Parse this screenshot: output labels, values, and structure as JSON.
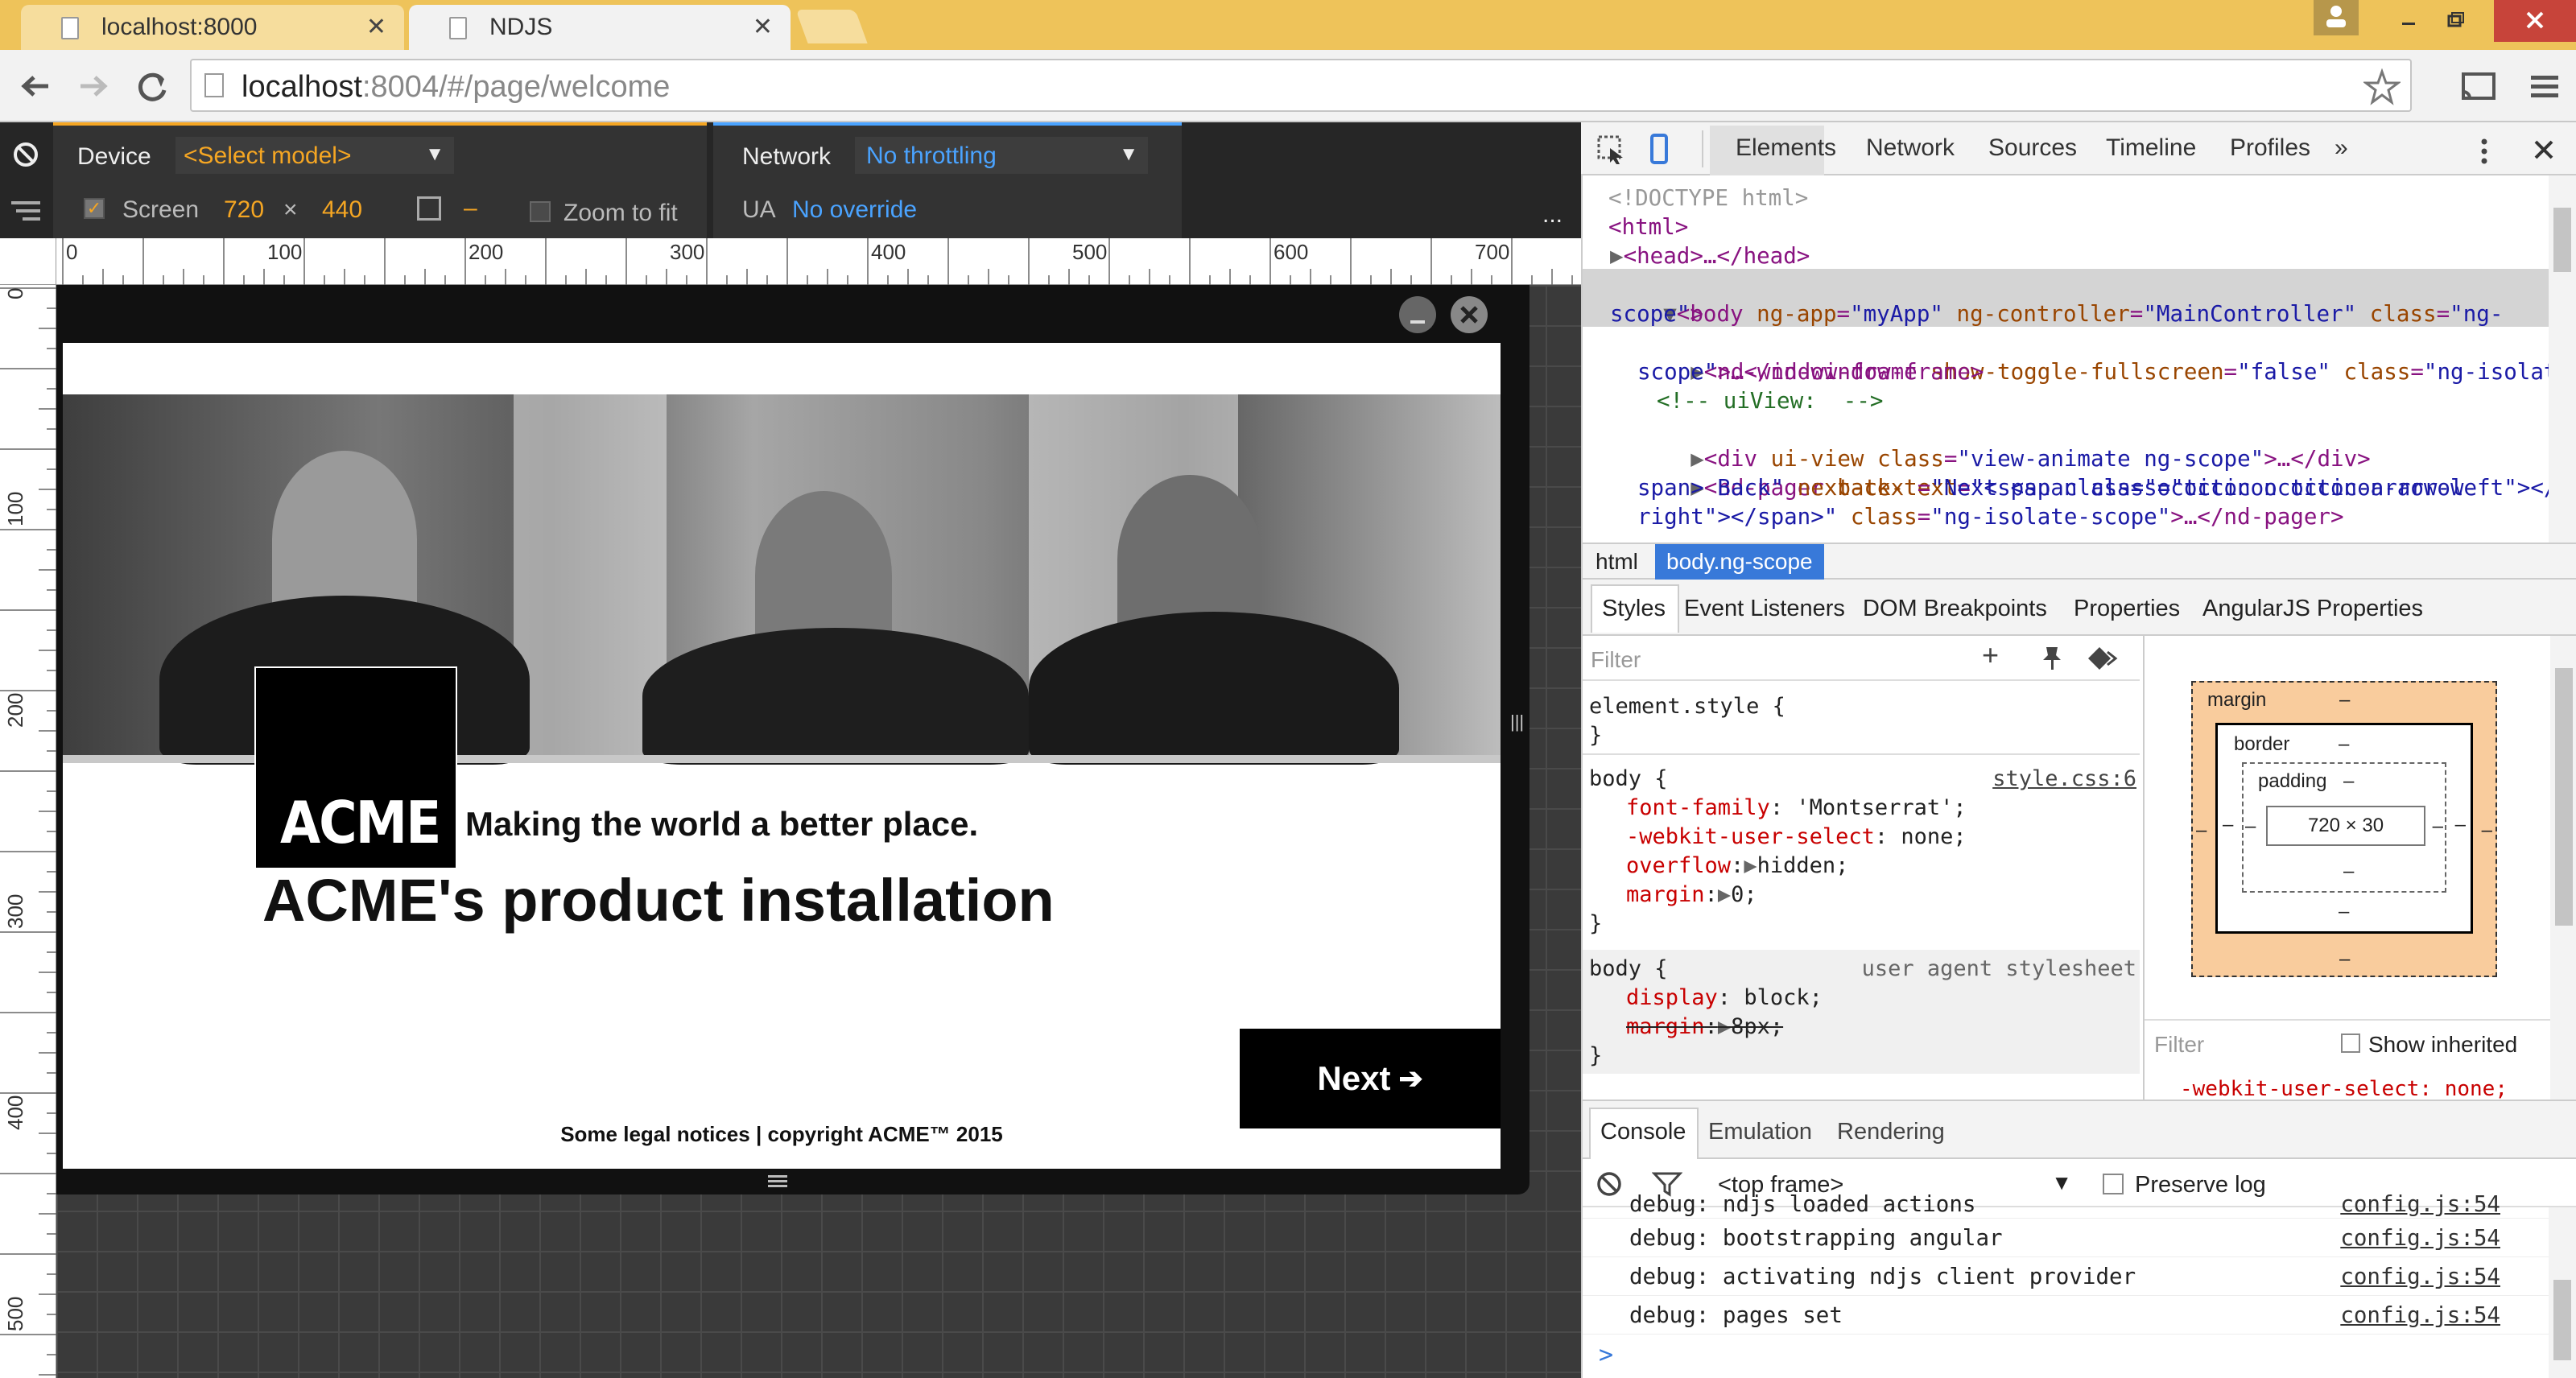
{
  "browser": {
    "tabs": [
      {
        "label": "localhost:8000",
        "active": false
      },
      {
        "label": "NDJS",
        "active": true
      }
    ],
    "url": {
      "host": "localhost",
      "rest": ":8004/#/page/welcome"
    }
  },
  "device_toolbar": {
    "device_label": "Device",
    "device_model": "<Select model>",
    "screen_label": "Screen",
    "screen_width": "720",
    "times": "×",
    "screen_height": "440",
    "dash": "–",
    "zoom_to_fit": "Zoom to fit",
    "network_label": "Network",
    "network_value": "No throttling",
    "ua_label": "UA",
    "ua_value": "No override",
    "more": "..."
  },
  "ruler": {
    "h_ticks": [
      "0",
      "100",
      "200",
      "300",
      "400",
      "500",
      "600",
      "700"
    ],
    "v_ticks": [
      "0",
      "100",
      "200",
      "300",
      "400",
      "500"
    ]
  },
  "app": {
    "logo": "ACME",
    "tagline": "Making the world a better place.",
    "title": "ACME's product installation",
    "next_button": "Next",
    "legal": "Some legal notices | copyright ACME™ 2015"
  },
  "devtools": {
    "tabs": [
      "Elements",
      "Network",
      "Sources",
      "Timeline",
      "Profiles",
      "»"
    ],
    "active_tab": "Elements",
    "breadcrumbs": [
      "html",
      "body.ng-scope"
    ],
    "style_tabs": [
      "Styles",
      "Event Listeners",
      "DOM Breakpoints",
      "Properties",
      "AngularJS Properties"
    ],
    "filter_placeholder": "Filter",
    "element_style": "element.style {",
    "close_brace": "}",
    "rule1_selector": "body {",
    "rule1_source": "style.css:6",
    "rule1_props": [
      {
        "name": "font-family",
        "value": "'Montserrat';"
      },
      {
        "name": "-webkit-user-select",
        "value": "none;"
      },
      {
        "name": "overflow",
        "value": "hidden;"
      },
      {
        "name": "margin",
        "value": "0;"
      }
    ],
    "rule2_selector": "body {",
    "rule2_source": "user agent stylesheet",
    "rule2_props": [
      {
        "name": "display",
        "value": "block;"
      },
      {
        "name": "margin",
        "value": "8px;"
      }
    ],
    "boxmodel": {
      "margin": "margin",
      "border": "border",
      "padding": "padding",
      "dash": "–",
      "content": "720 × 30"
    },
    "computed_filter": "Filter",
    "show_inherited": "Show inherited",
    "computed_preview": "-webkit-user-select: none;",
    "console_tabs": [
      "Console",
      "Emulation",
      "Rendering"
    ],
    "frame_select": "<top frame>",
    "preserve_log": "Preserve log",
    "console_partial": "debug: ndjs loaded actions",
    "console_partial_source": "config.js:54",
    "console_lines": [
      {
        "msg": "debug: bootstrapping angular",
        "src": "config.js:54"
      },
      {
        "msg": "debug: activating ndjs client provider",
        "src": "config.js:54"
      },
      {
        "msg": "debug: pages set",
        "src": "config.js:54"
      }
    ],
    "prompt": ">"
  },
  "dom_tree": {
    "doctype": "<!DOCTYPE html>",
    "html_open": "<html>",
    "head": "<head>…</head>",
    "body_tag": "<body",
    "body_attr1": "ng-app",
    "body_val1": "\"myApp\"",
    "body_attr2": "ng-controller",
    "body_val2": "\"MainController\"",
    "body_attr3": "class",
    "body_val3a": "\"ng-",
    "body_val3b": "scope\"",
    "body_close": ">",
    "frame_tag": "<nd-window-frame",
    "frame_attr1": "show-toggle-fullscreen",
    "frame_val1": "\"false\"",
    "frame_attr2": "class",
    "frame_val2a": "\"ng-isolate-",
    "frame_val2b": "scope\"",
    "frame_end": ">…</nd-window-frame>",
    "comment": "<!-- uiView:  -->",
    "div_tag": "<div",
    "div_attr1": "ui-view",
    "div_attr2": "class",
    "div_val2": "\"view-animate ng-scope\"",
    "div_end": ">…</div>",
    "pager_tag": "<nd-pager",
    "pager_attr1": "back-text",
    "pager_val1a": "\"<span class=\"octicon octicon-arrow-left\"></",
    "pager_val1b": "span> Back\"",
    "pager_attr2": "next-text",
    "pager_val2a": "\"Next <span class=\"octicon octicon-arrow-",
    "pager_val2b": "right\"></span>\"",
    "pager_attr3": "class",
    "pager_val3": "\"ng-isolate-scope\"",
    "pager_end": ">…</nd-pager>"
  },
  "colors": {
    "tabbar": "#eec35a",
    "accent_orange": "#f5a623",
    "accent_blue": "#4aa3ff",
    "selected_crumb": "#3879d9"
  }
}
